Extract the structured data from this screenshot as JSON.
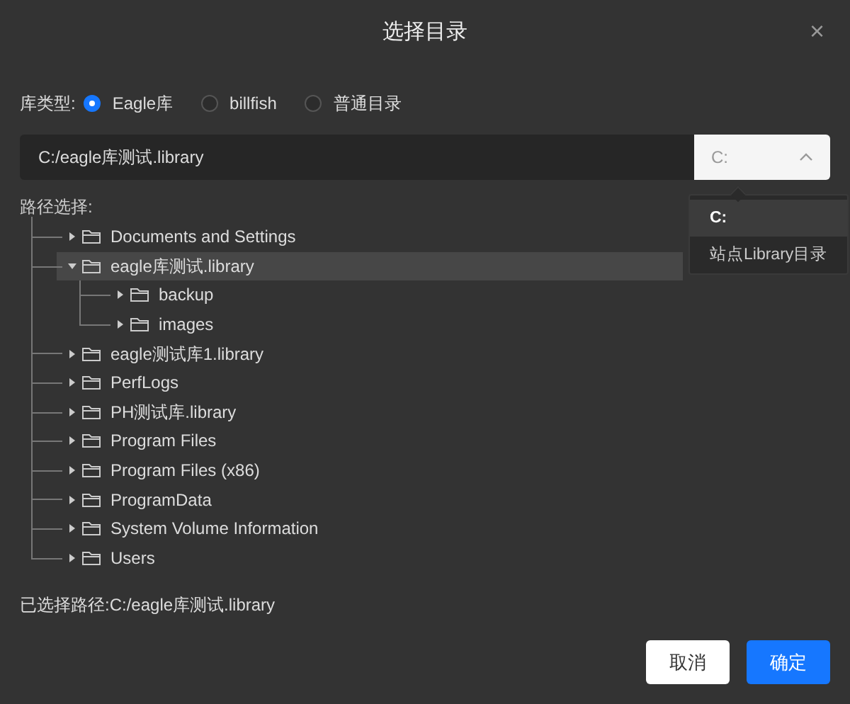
{
  "dialog": {
    "title": "选择目录",
    "close": "×"
  },
  "library_type": {
    "label": "库类型:",
    "options": [
      {
        "label": "Eagle库",
        "selected": true
      },
      {
        "label": "billfish",
        "selected": false
      },
      {
        "label": "普通目录",
        "selected": false
      }
    ]
  },
  "path_input": {
    "value": "C:/eagle库测试.library"
  },
  "drive_select": {
    "value": "C:",
    "expanded": true,
    "options": [
      {
        "label": "C:",
        "selected": true
      },
      {
        "label": "站点Library目录",
        "selected": false
      }
    ]
  },
  "tree": {
    "label": "路径选择:",
    "items": [
      {
        "label": "Documents and Settings",
        "expanded": false,
        "selected": false
      },
      {
        "label": "eagle库测试.library",
        "expanded": true,
        "selected": true,
        "children": [
          {
            "label": "backup",
            "expanded": false,
            "selected": false
          },
          {
            "label": "images",
            "expanded": false,
            "selected": false
          }
        ]
      },
      {
        "label": "eagle测试库1.library",
        "expanded": false,
        "selected": false
      },
      {
        "label": "PerfLogs",
        "expanded": false,
        "selected": false
      },
      {
        "label": "PH测试库.library",
        "expanded": false,
        "selected": false
      },
      {
        "label": "Program Files",
        "expanded": false,
        "selected": false
      },
      {
        "label": "Program Files (x86)",
        "expanded": false,
        "selected": false
      },
      {
        "label": "ProgramData",
        "expanded": false,
        "selected": false
      },
      {
        "label": "System Volume Information",
        "expanded": false,
        "selected": false
      },
      {
        "label": "Users",
        "expanded": false,
        "selected": false
      }
    ]
  },
  "selected_path": "已选择路径:C:/eagle库测试.library",
  "buttons": [
    {
      "label": "取消",
      "kind": "secondary"
    },
    {
      "label": "确定",
      "kind": "primary"
    }
  ]
}
